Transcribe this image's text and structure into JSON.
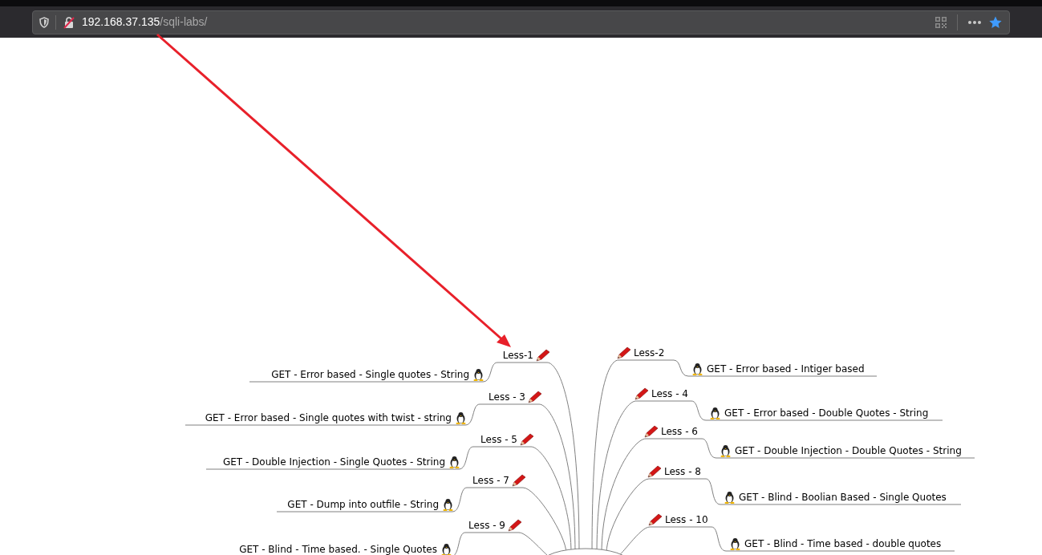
{
  "address_bar": {
    "host": "192.168.37.135",
    "path": "/sqli-labs/"
  },
  "mindmap": {
    "left": [
      {
        "label": "Less-1",
        "leaf": "GET - Error based - Single quotes - String"
      },
      {
        "label": "Less - 3",
        "leaf": "GET - Error based - Single quotes with twist - string"
      },
      {
        "label": "Less - 5",
        "leaf": "GET - Double Injection - Single Quotes - String"
      },
      {
        "label": "Less - 7",
        "leaf": "GET - Dump into outfile - String"
      },
      {
        "label": "Less - 9",
        "leaf": "GET - Blind - Time based. -  Single Quotes"
      }
    ],
    "right": [
      {
        "label": "Less-2",
        "leaf": "GET - Error based - Intiger based"
      },
      {
        "label": "Less - 4",
        "leaf": "GET - Error based - Double Quotes - String"
      },
      {
        "label": "Less - 6",
        "leaf": "GET - Double Injection - Double Quotes - String"
      },
      {
        "label": "Less - 8",
        "leaf": "GET - Blind - Boolian Based - Single Quotes"
      },
      {
        "label": "Less - 10",
        "leaf": "GET - Blind - Time based - double quotes"
      }
    ]
  }
}
